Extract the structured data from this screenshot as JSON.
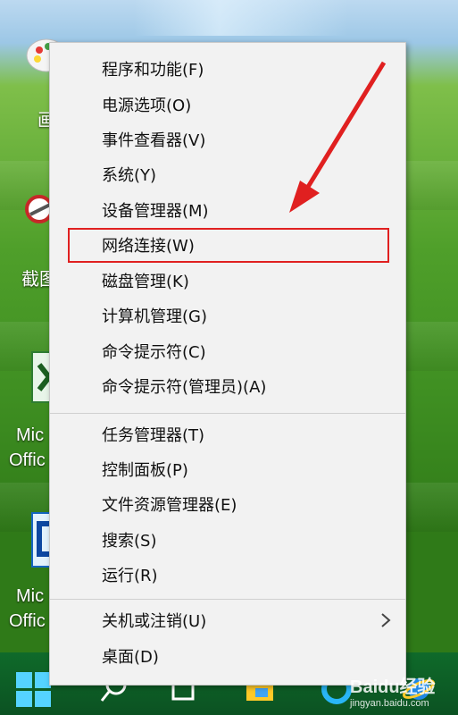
{
  "desktop": {
    "icons": [
      {
        "name": "paint",
        "label": "画"
      },
      {
        "name": "snip",
        "label": "截图"
      },
      {
        "name": "excel",
        "label_line1": "Mic",
        "label_line2": "Offic"
      },
      {
        "name": "project",
        "label_line1": "Mic",
        "label_line2": "Offic"
      }
    ]
  },
  "menu": {
    "group1": [
      "程序和功能(F)",
      "电源选项(O)",
      "事件查看器(V)",
      "系统(Y)",
      "设备管理器(M)",
      "网络连接(W)",
      "磁盘管理(K)",
      "计算机管理(G)",
      "命令提示符(C)",
      "命令提示符(管理员)(A)"
    ],
    "group2": [
      "任务管理器(T)",
      "控制面板(P)",
      "文件资源管理器(E)",
      "搜索(S)",
      "运行(R)"
    ],
    "group3": [
      "关机或注销(U)",
      "桌面(D)"
    ],
    "highlighted_item": "网络连接(W)"
  },
  "annotation": {
    "color": "#e02020"
  },
  "watermark": {
    "brand": "Baidu经验",
    "url": "jingyan.baidu.com"
  }
}
